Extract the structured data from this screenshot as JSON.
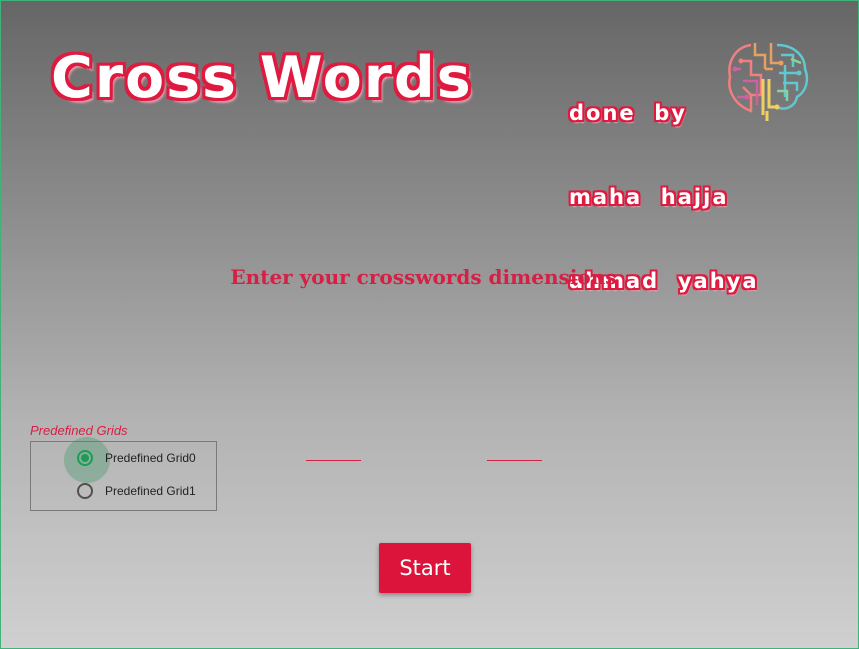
{
  "header": {
    "logo_text": "Cross Words",
    "credits": [
      "done  by",
      "maha  hajja",
      "ahmad  yahya"
    ]
  },
  "main": {
    "heading": "Enter your crosswords dimensions",
    "predefined_grids": {
      "title": "Predefined Grids",
      "options": [
        {
          "label": "Predefined Grid0",
          "checked": true
        },
        {
          "label": "Predefined Grid1",
          "checked": false
        }
      ]
    },
    "rows_input": {
      "value": "",
      "placeholder": ""
    },
    "cols_input": {
      "value": "",
      "placeholder": ""
    },
    "start_label": "Start"
  },
  "colors": {
    "accent": "#dc143c",
    "radio_checked": "#1a9e55",
    "window_border": "#3fb37a"
  },
  "icons": {
    "brain": "brain-circuit-icon",
    "radio_checked": "radio-checked-icon",
    "radio_unchecked": "radio-unchecked-icon"
  }
}
